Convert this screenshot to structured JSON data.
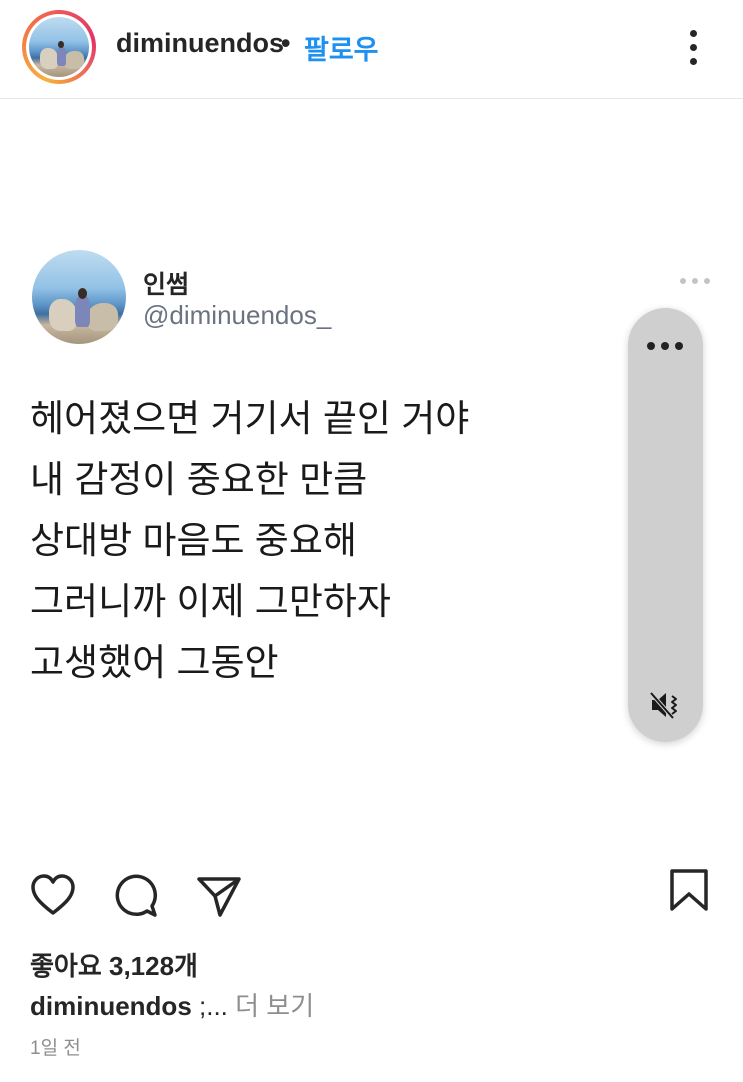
{
  "header": {
    "username": "diminuendos",
    "separator": "•",
    "follow_label": "팔로우"
  },
  "tweet": {
    "display_name": "인썸",
    "handle": "@diminuendos_",
    "lines": [
      "헤어졌으면 거기서 끝인 거야",
      "내 감정이 중요한 만큼",
      "상대방 마음도 중요해",
      "그러니까 이제 그만하자",
      "고생했어 그동안"
    ]
  },
  "actions": {
    "icons": [
      "heart-icon",
      "comment-icon",
      "share-icon",
      "save-icon"
    ]
  },
  "likes_text": "좋아요 3,128개",
  "caption": {
    "username": "diminuendos",
    "text": " ;...",
    "more": " 더 보기"
  },
  "timestamp": "1일 전",
  "colors": {
    "follow": "#1e90f0",
    "pill": "#cfcfcf",
    "muted_text": "#8e8e8e"
  }
}
